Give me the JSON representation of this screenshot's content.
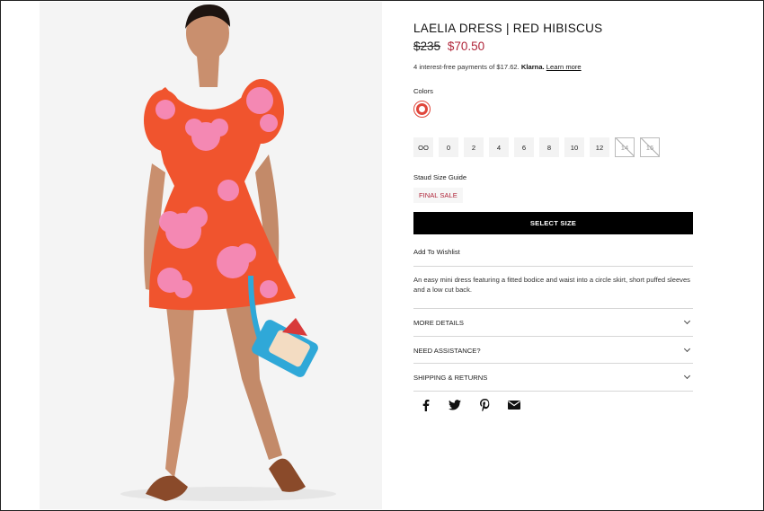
{
  "product": {
    "title": "LAELIA DRESS | RED HIBISCUS",
    "price_original": "$235",
    "price_sale": "$70.50",
    "installments_text": "4 interest-free payments of $17.62.",
    "installments_provider": "Klarna.",
    "learn_more": "Learn more",
    "colors_label": "Colors",
    "selected_color": "#e0463b",
    "sizes": [
      {
        "label": "OO",
        "available": true
      },
      {
        "label": "0",
        "available": true
      },
      {
        "label": "2",
        "available": true
      },
      {
        "label": "4",
        "available": true
      },
      {
        "label": "6",
        "available": true
      },
      {
        "label": "8",
        "available": true
      },
      {
        "label": "10",
        "available": true
      },
      {
        "label": "12",
        "available": true
      },
      {
        "label": "14",
        "available": false
      },
      {
        "label": "16",
        "available": false
      }
    ],
    "size_guide": "Staud Size Guide",
    "final_sale": "FINAL SALE",
    "select_size": "SELECT SIZE",
    "wishlist": "Add To Wishlist",
    "description": "An easy mini dress featuring a fitted bodice and waist into a circle skirt, short puffed sleeves and a low cut back.",
    "accordions": [
      "MORE DETAILS",
      "NEED ASSISTANCE?",
      "SHIPPING & RETURNS"
    ]
  },
  "social": [
    "facebook-icon",
    "twitter-icon",
    "pinterest-icon",
    "email-icon"
  ],
  "colors": {
    "accent": "#b0263a",
    "dress": "#f0542e",
    "flower": "#f58bbb",
    "button": "#000000"
  }
}
